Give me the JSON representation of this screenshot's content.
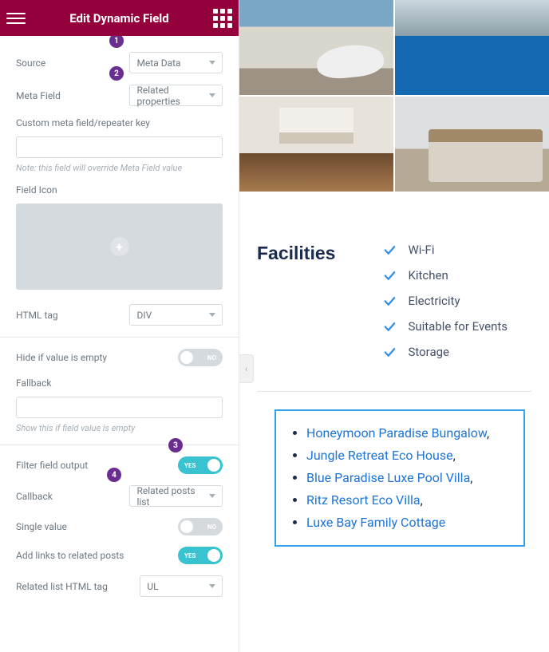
{
  "topbar": {
    "title": "Edit Dynamic Field"
  },
  "badges": {
    "b1": "1",
    "b2": "2",
    "b3": "3",
    "b4": "4"
  },
  "panel": {
    "source_label": "Source",
    "source_value": "Meta Data",
    "metafield_label": "Meta Field",
    "metafield_value": "Related properties",
    "custom_key_label": "Custom meta field/repeater key",
    "custom_key_value": "",
    "custom_key_note": "Note: this field will override Meta Field value",
    "fieldicon_label": "Field Icon",
    "htmltag_label": "HTML tag",
    "htmltag_value": "DIV",
    "hideempty_label": "Hide if value is empty",
    "hideempty_state": "NO",
    "fallback_label": "Fallback",
    "fallback_value": "",
    "fallback_note": "Show this if field value is empty",
    "filter_label": "Filter field output",
    "filter_state": "YES",
    "callback_label": "Callback",
    "callback_value": "Related posts list",
    "single_label": "Single value",
    "single_state": "NO",
    "addlinks_label": "Add links to related posts",
    "addlinks_state": "YES",
    "listtag_label": "Related list HTML tag",
    "listtag_value": "UL"
  },
  "preview": {
    "facilities_title": "Facilities",
    "facilities": [
      "Wi-Fi",
      "Kitchen",
      "Electricity",
      "Suitable for Events",
      "Storage"
    ],
    "related": [
      "Honeymoon Paradise Bungalow",
      "Jungle Retreat Eco House",
      "Blue Paradise Luxe Pool Villa",
      "Ritz Resort Eco Villa",
      "Luxe Bay Family Cottage"
    ]
  }
}
